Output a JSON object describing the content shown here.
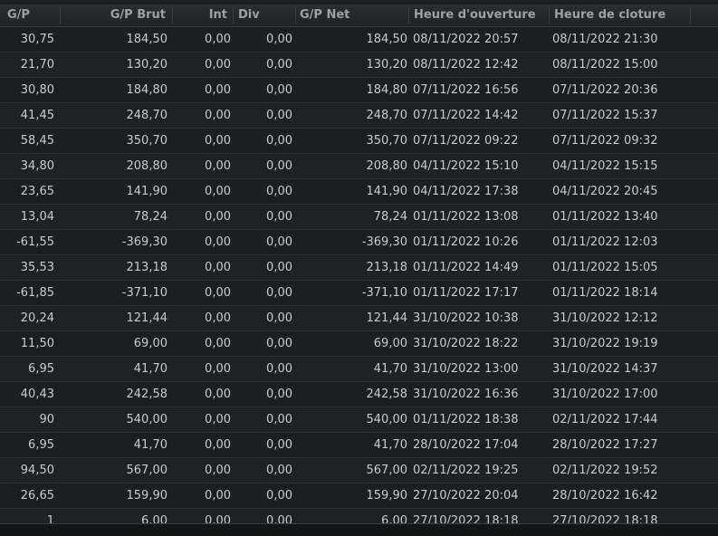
{
  "columns": [
    "G/P",
    "G/P Brut",
    "Int",
    "Div",
    "G/P Net",
    "Heure d'ouverture",
    "Heure de cloture"
  ],
  "rows": [
    [
      "30,75",
      "184,50",
      "0,00",
      "0,00",
      "184,50",
      "08/11/2022 20:57",
      "08/11/2022 21:30"
    ],
    [
      "21,70",
      "130,20",
      "0,00",
      "0,00",
      "130,20",
      "08/11/2022 12:42",
      "08/11/2022 15:00"
    ],
    [
      "30,80",
      "184,80",
      "0,00",
      "0,00",
      "184,80",
      "07/11/2022 16:56",
      "07/11/2022 20:36"
    ],
    [
      "41,45",
      "248,70",
      "0,00",
      "0,00",
      "248,70",
      "07/11/2022 14:42",
      "07/11/2022 15:37"
    ],
    [
      "58,45",
      "350,70",
      "0,00",
      "0,00",
      "350,70",
      "07/11/2022 09:22",
      "07/11/2022 09:32"
    ],
    [
      "34,80",
      "208,80",
      "0,00",
      "0,00",
      "208,80",
      "04/11/2022 15:10",
      "04/11/2022 15:15"
    ],
    [
      "23,65",
      "141,90",
      "0,00",
      "0,00",
      "141,90",
      "04/11/2022 17:38",
      "04/11/2022 20:45"
    ],
    [
      "13,04",
      "78,24",
      "0,00",
      "0,00",
      "78,24",
      "01/11/2022 13:08",
      "01/11/2022 13:40"
    ],
    [
      "-61,55",
      "-369,30",
      "0,00",
      "0,00",
      "-369,30",
      "01/11/2022 10:26",
      "01/11/2022 12:03"
    ],
    [
      "35,53",
      "213,18",
      "0,00",
      "0,00",
      "213,18",
      "01/11/2022 14:49",
      "01/11/2022 15:05"
    ],
    [
      "-61,85",
      "-371,10",
      "0,00",
      "0,00",
      "-371,10",
      "01/11/2022 17:17",
      "01/11/2022 18:14"
    ],
    [
      "20,24",
      "121,44",
      "0,00",
      "0,00",
      "121,44",
      "31/10/2022 10:38",
      "31/10/2022 12:12"
    ],
    [
      "11,50",
      "69,00",
      "0,00",
      "0,00",
      "69,00",
      "31/10/2022 18:22",
      "31/10/2022 19:19"
    ],
    [
      "6,95",
      "41,70",
      "0,00",
      "0,00",
      "41,70",
      "31/10/2022 13:00",
      "31/10/2022 14:37"
    ],
    [
      "40,43",
      "242,58",
      "0,00",
      "0,00",
      "242,58",
      "31/10/2022 16:36",
      "31/10/2022 17:00"
    ],
    [
      "90",
      "540,00",
      "0,00",
      "0,00",
      "540,00",
      "01/11/2022 18:38",
      "02/11/2022 17:44"
    ],
    [
      "6,95",
      "41,70",
      "0,00",
      "0,00",
      "41,70",
      "28/10/2022 17:04",
      "28/10/2022 17:27"
    ],
    [
      "94,50",
      "567,00",
      "0,00",
      "0,00",
      "567,00",
      "02/11/2022 19:25",
      "02/11/2022 19:52"
    ],
    [
      "26,65",
      "159,90",
      "0,00",
      "0,00",
      "159,90",
      "27/10/2022 20:04",
      "28/10/2022 16:42"
    ],
    [
      "1",
      "6,00",
      "0,00",
      "0,00",
      "6,00",
      "27/10/2022 18:18",
      "27/10/2022 18:18"
    ]
  ]
}
